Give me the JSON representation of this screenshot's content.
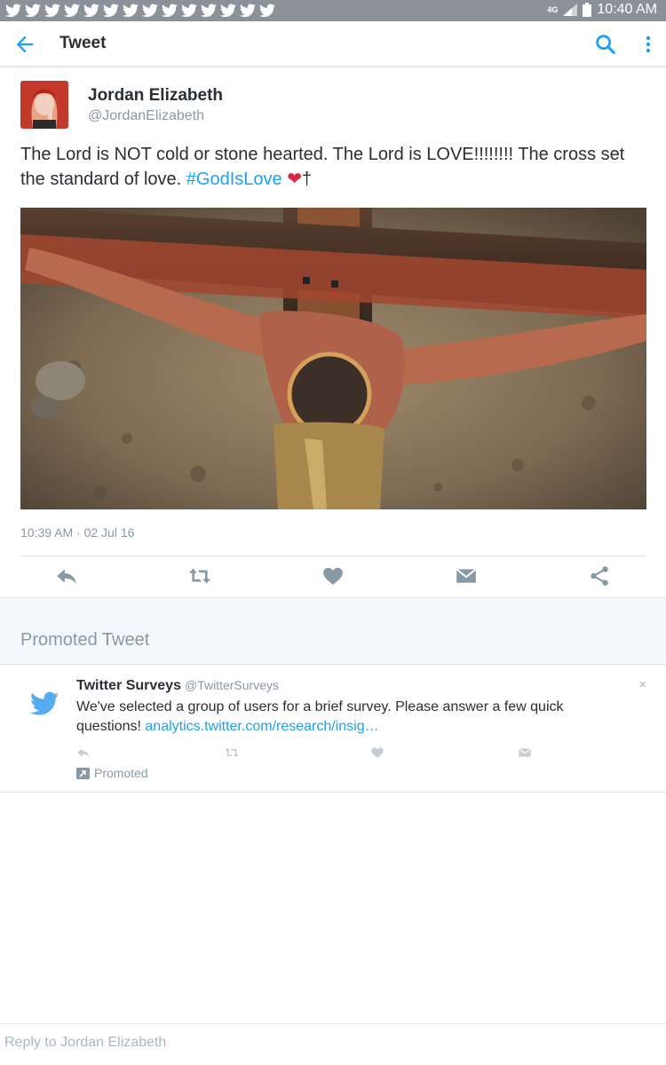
{
  "status_bar": {
    "network": "4G",
    "time": "10:40 AM",
    "notification_icons": [
      "bird-icon",
      "bird-icon",
      "bird-icon",
      "bird-icon",
      "bird-icon",
      "bird-icon",
      "bird-icon",
      "bird-icon",
      "bird-icon",
      "bird-icon",
      "bird-icon",
      "bird-icon",
      "bird-icon",
      "bird-icon"
    ]
  },
  "app_bar": {
    "title": "Tweet"
  },
  "tweet": {
    "author_name": "Jordan Elizabeth",
    "author_handle": "@JordanElizabeth",
    "text_main": "The Lord is NOT cold or stone hearted. The Lord is LOVE!!!!!!!! The cross set the standard of love. ",
    "hashtag": "#GodIsLove",
    "emoji": "❤",
    "cross": "†",
    "timestamp": "10:39 AM · 02 Jul 16"
  },
  "promoted": {
    "section_label": "Promoted Tweet",
    "name": "Twitter Surveys",
    "handle": "@TwitterSurveys",
    "close": "×",
    "text": "We've selected a group of users for a brief survey. Please answer a few quick questions! ",
    "link": "analytics.twitter.com/research/insig…",
    "badge": "Promoted"
  },
  "reply": {
    "placeholder": "Reply to Jordan Elizabeth"
  },
  "colors": {
    "accent": "#1da1f2",
    "muted": "#8899a6",
    "status_bar": "#8a9199"
  }
}
